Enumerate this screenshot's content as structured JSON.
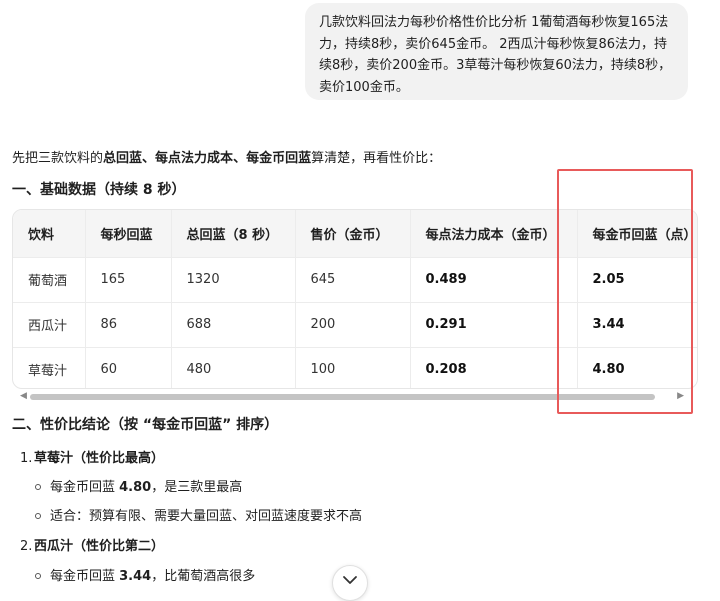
{
  "user_message": "几款饮料回法力每秒价格性价比分析 1葡萄酒每秒恢复165法力，持续8秒，卖价645金币。 2西瓜汁每秒恢复86法力，持续8秒，卖价200金币。3草莓汁每秒恢复60法力，持续8秒，卖价100金币。",
  "intro": {
    "prefix": "先把三款饮料的",
    "term1": "总回蓝",
    "sep1": "、",
    "term2": "每点法力成本",
    "sep2": "、",
    "term3": "每金币回蓝",
    "suffix": "算清楚，再看性价比："
  },
  "section1_title": "一、基础数据（持续 8 秒）",
  "table": {
    "headers": [
      "饮料",
      "每秒回蓝",
      "总回蓝（8 秒）",
      "售价（金币）",
      "每点法力成本（金币）",
      "每金币回蓝（点）"
    ],
    "rows": [
      [
        "葡萄酒",
        "165",
        "1320",
        "645",
        "0.489",
        "2.05"
      ],
      [
        "西瓜汁",
        "86",
        "688",
        "200",
        "0.291",
        "3.44"
      ],
      [
        "草莓汁",
        "60",
        "480",
        "100",
        "0.208",
        "4.80"
      ]
    ]
  },
  "section2_title": "二、性价比结论（按 “每金币回蓝” 排序）",
  "ranking": [
    {
      "number": "1.",
      "title": "草莓汁（性价比最高）",
      "bullets": [
        {
          "prefix": "每金币回蓝 ",
          "value": "4.80",
          "suffix": "，是三款里最高"
        },
        {
          "prefix": "适合：预算有限、需要大量回蓝、对回蓝速度要求不高",
          "value": "",
          "suffix": ""
        }
      ]
    },
    {
      "number": "2.",
      "title": "西瓜汁（性价比第二）",
      "bullets": [
        {
          "prefix": "每金币回蓝 ",
          "value": "3.44",
          "suffix": "，比葡萄酒高很多"
        }
      ]
    }
  ],
  "colors": {
    "highlight": "#e85a5a",
    "bubble": "#f2f2f2",
    "table_header": "#f5f5f5"
  },
  "icons": {
    "scroll_down": "chevron-down-icon",
    "scroll_left": "triangle-left-icon",
    "scroll_right": "triangle-right-icon"
  }
}
